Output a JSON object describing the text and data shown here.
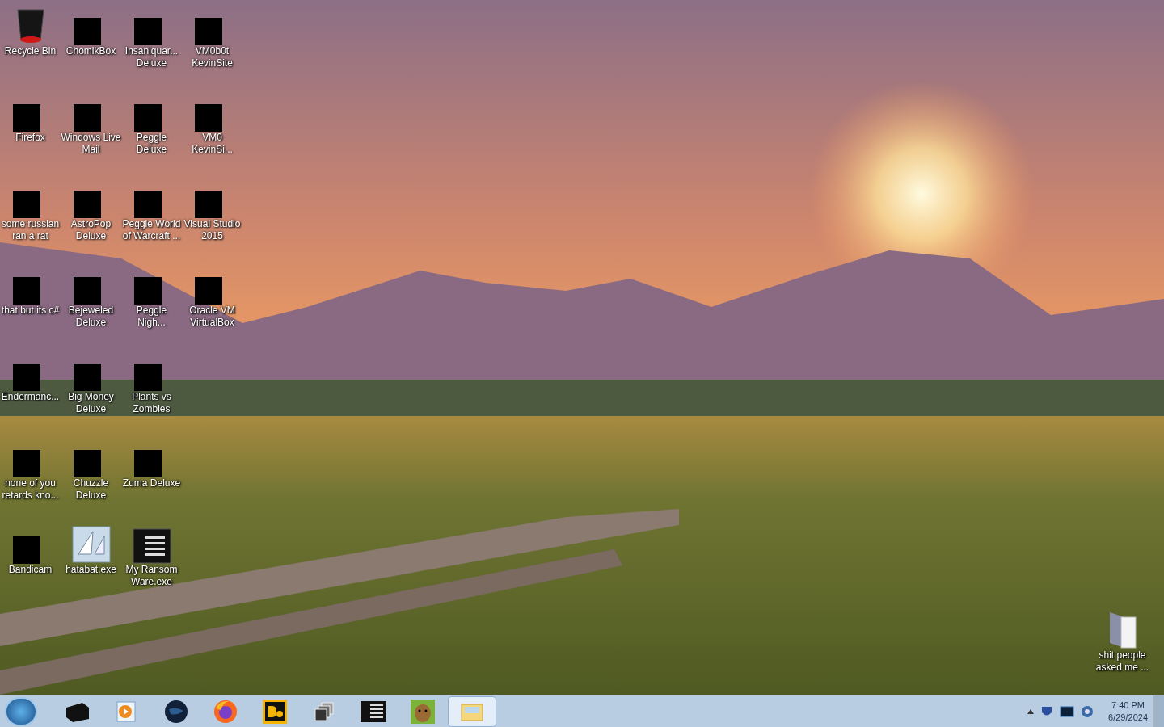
{
  "desktop_icons": [
    [
      {
        "label": "Recycle Bin",
        "kind": "bin"
      },
      {
        "label": "ChomikBox",
        "kind": "redacted"
      },
      {
        "label": "Insaniquar... Deluxe",
        "kind": "redacted"
      },
      {
        "label": "VM0b0t KevinSite",
        "kind": "redacted"
      }
    ],
    [
      {
        "label": "Firefox",
        "kind": "redacted"
      },
      {
        "label": "Windows Live Mail",
        "kind": "redacted"
      },
      {
        "label": "Peggle Deluxe",
        "kind": "redacted"
      },
      {
        "label": "VM0 KevinSi...",
        "kind": "redacted"
      }
    ],
    [
      {
        "label": "some russian ran a rat",
        "kind": "redacted"
      },
      {
        "label": "AstroPop Deluxe",
        "kind": "redacted"
      },
      {
        "label": "Peggle World of Warcraft ...",
        "kind": "redacted"
      },
      {
        "label": "Visual Studio 2015",
        "kind": "redacted"
      }
    ],
    [
      {
        "label": "that but its c#",
        "kind": "redacted"
      },
      {
        "label": "Bejeweled Deluxe",
        "kind": "redacted"
      },
      {
        "label": "Peggle Nigh...",
        "kind": "redacted"
      },
      {
        "label": "Oracle VM VirtualBox",
        "kind": "redacted"
      }
    ],
    [
      {
        "label": "Endermanc...",
        "kind": "redacted"
      },
      {
        "label": "Big Money Deluxe",
        "kind": "redacted"
      },
      {
        "label": "Plants vs Zombies",
        "kind": "redacted"
      }
    ],
    [
      {
        "label": "none of you retards kno...",
        "kind": "redacted"
      },
      {
        "label": "Chuzzle Deluxe",
        "kind": "redacted"
      },
      {
        "label": "Zuma Deluxe",
        "kind": "redacted"
      }
    ],
    [
      {
        "label": "Bandicam",
        "kind": "redacted"
      },
      {
        "label": "hatabat.exe",
        "kind": "picture"
      },
      {
        "label": "My Ransom Ware.exe",
        "kind": "console"
      }
    ]
  ],
  "corner_icon": {
    "label": "shit people asked me ...",
    "kind": "document"
  },
  "taskbar": {
    "apps": [
      {
        "kind": "box",
        "selected": false
      },
      {
        "kind": "media",
        "selected": false
      },
      {
        "kind": "globe",
        "selected": false
      },
      {
        "kind": "firefox",
        "selected": false
      },
      {
        "kind": "de",
        "selected": false
      },
      {
        "kind": "windows",
        "selected": false
      },
      {
        "kind": "console",
        "selected": false
      },
      {
        "kind": "bear",
        "selected": false
      },
      {
        "kind": "explorer",
        "selected": true
      }
    ],
    "time": "7:40 PM",
    "date": "6/29/2024"
  }
}
